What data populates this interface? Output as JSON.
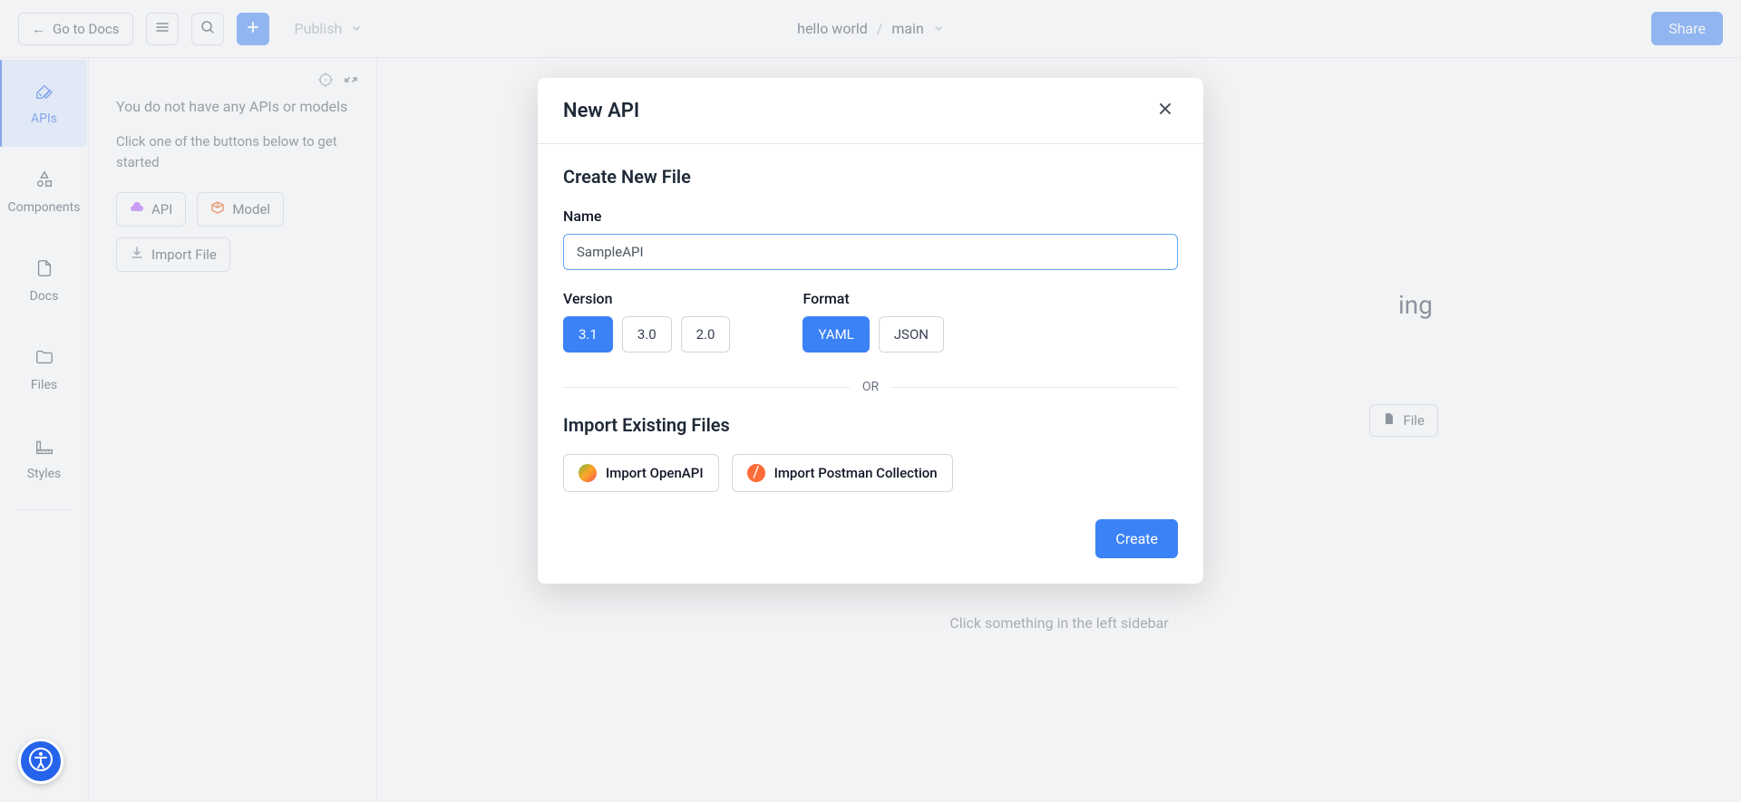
{
  "toolbar": {
    "back_label": "Go to Docs",
    "publish_label": "Publish",
    "project_name": "hello world",
    "branch": "main",
    "share_label": "Share"
  },
  "sidebar": {
    "items": [
      {
        "label": "APIs"
      },
      {
        "label": "Components"
      },
      {
        "label": "Docs"
      },
      {
        "label": "Files"
      },
      {
        "label": "Styles"
      }
    ]
  },
  "panel": {
    "empty_msg": "You do not have any APIs or models",
    "empty_sub": "Click one of the buttons below to get started",
    "api_label": "API",
    "model_label": "Model",
    "import_label": "Import File"
  },
  "content": {
    "hint": "Click something in the left sidebar",
    "file_label": "File",
    "bg_partial": "ing"
  },
  "modal": {
    "title": "New API",
    "create_title": "Create New File",
    "name_label": "Name",
    "name_value": "SampleAPI",
    "version_label": "Version",
    "format_label": "Format",
    "versions": [
      "3.1",
      "3.0",
      "2.0"
    ],
    "formats": [
      "YAML",
      "JSON"
    ],
    "or_text": "OR",
    "import_title": "Import Existing Files",
    "import_openapi": "Import OpenAPI",
    "import_postman": "Import Postman Collection",
    "create_label": "Create"
  }
}
